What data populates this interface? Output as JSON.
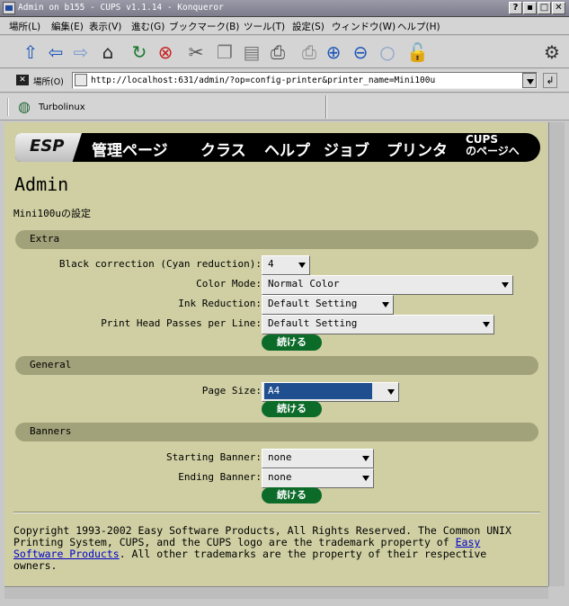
{
  "window": {
    "title": "Admin on b155 - CUPS v1.1.14 - Konqueror",
    "buttons": [
      "?",
      "▪",
      "□",
      "✕"
    ]
  },
  "menubar": [
    "場所(L)",
    "編集(E)",
    "表示(V)",
    "進む(G)",
    "ブックマーク(B)",
    "ツール(T)",
    "設定(S)",
    "ウィンドウ(W)",
    "ヘルプ(H)"
  ],
  "toolbar": {
    "icons": [
      "up-icon",
      "back-icon",
      "forward-icon",
      "home-icon",
      "reload-icon",
      "stop-icon",
      "cut-icon",
      "copy-icon",
      "paste-icon",
      "print-icon",
      "print-frame-icon",
      "zoom-in-icon",
      "zoom-out-icon",
      "find-icon",
      "security-icon"
    ]
  },
  "location": {
    "label": "場所(O)",
    "url": "http://localhost:631/admin/?op=config-printer&printer_name=Mini100u"
  },
  "bookmarks": {
    "item": "Turbolinux"
  },
  "nav": {
    "logo": "ESP",
    "links": [
      "管理ページ",
      "クラス",
      "ヘルプ",
      "ジョブ",
      "プリンタ"
    ],
    "cups_line1": "CUPS",
    "cups_line2": "のページへ"
  },
  "page": {
    "title": "Admin",
    "subtitle": "Mini100uの設定"
  },
  "sections": {
    "extra": {
      "title": "Extra",
      "fields": [
        {
          "label": "Black correction (Cyan reduction):",
          "value": "4"
        },
        {
          "label": "Color Mode:",
          "value": "Normal Color"
        },
        {
          "label": "Ink Reduction:",
          "value": "Default Setting"
        },
        {
          "label": "Print Head Passes per Line:",
          "value": "Default Setting"
        }
      ],
      "button": "続ける"
    },
    "general": {
      "title": "General",
      "fields": [
        {
          "label": "Page Size:",
          "value": "A4"
        }
      ],
      "button": "続ける"
    },
    "banners": {
      "title": "Banners",
      "fields": [
        {
          "label": "Starting Banner:",
          "value": "none"
        },
        {
          "label": "Ending Banner:",
          "value": "none"
        }
      ],
      "button": "続ける"
    }
  },
  "footer": {
    "line1": "Copyright 1993-2002 Easy Software Products, All Rights Reserved. The Common UNIX",
    "line2_pre": "Printing System, CUPS, and the CUPS logo are the trademark property of",
    "link_line2": "Easy",
    "link_line3": "Software Products",
    "line3_post": ". All other trademarks are the property of their respective",
    "line4": "owners."
  }
}
